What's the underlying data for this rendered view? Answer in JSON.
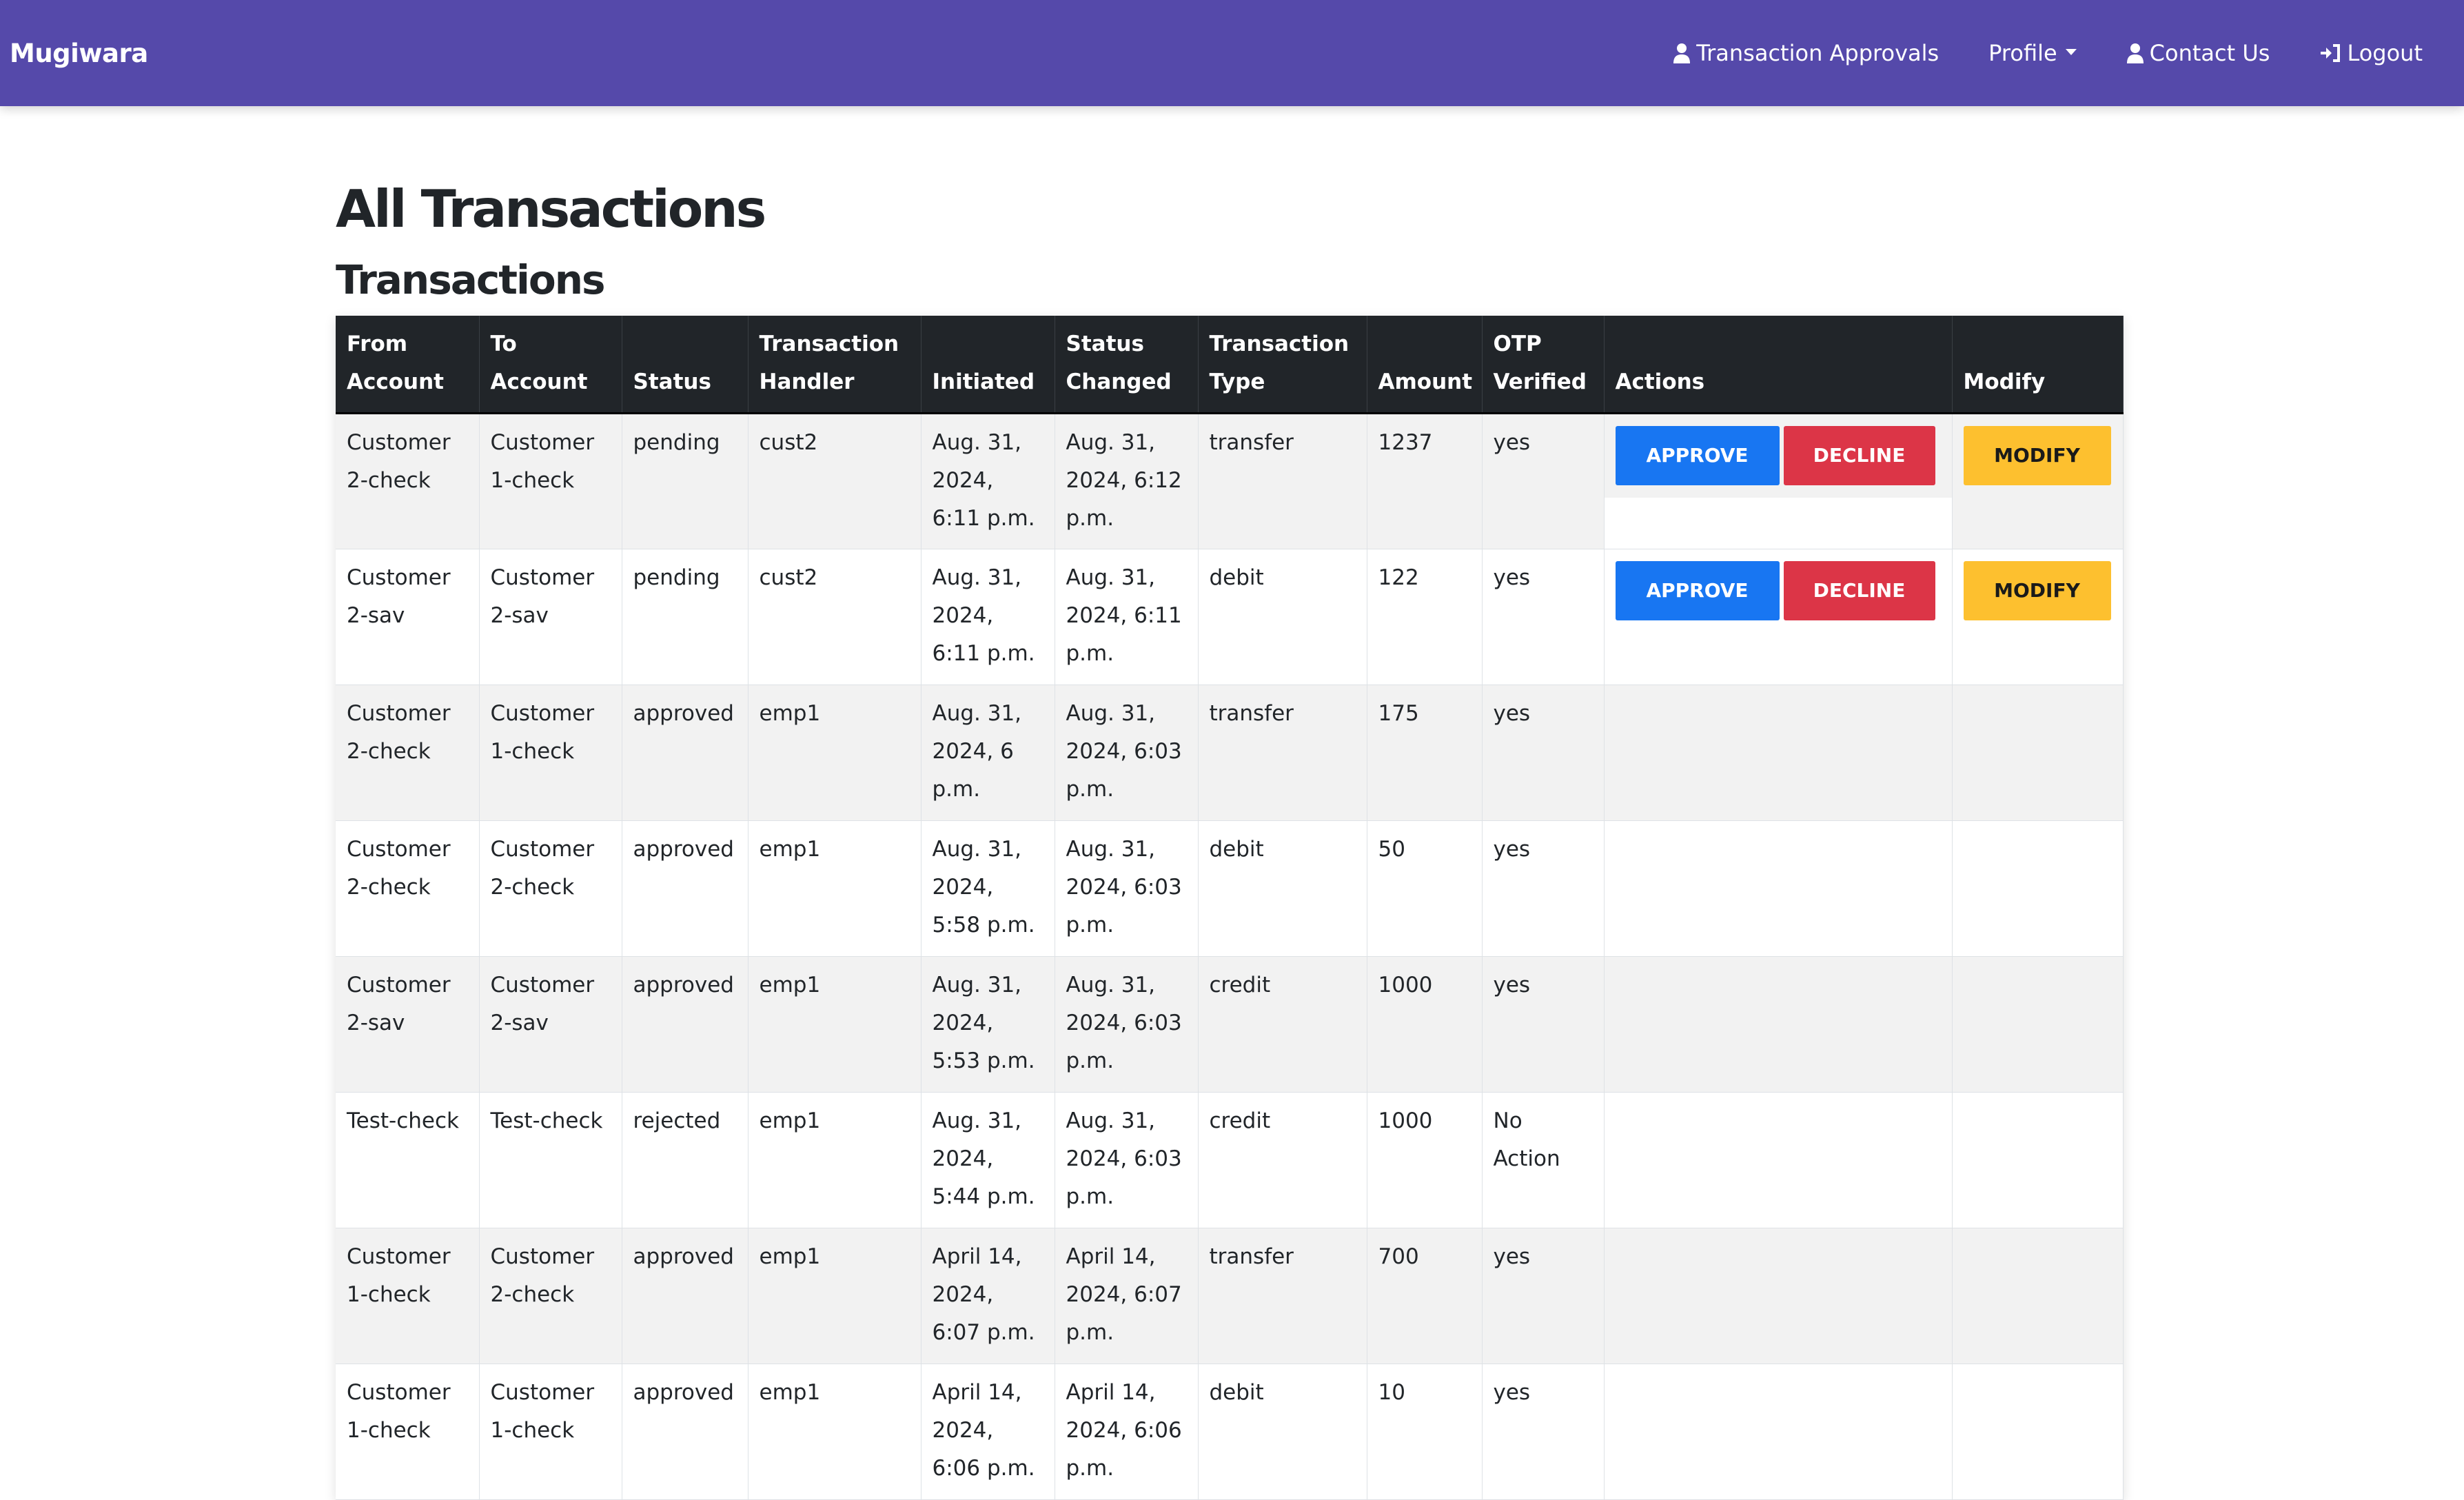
{
  "navbar": {
    "brand": "Mugiwara",
    "items": [
      {
        "label": "Transaction Approvals",
        "icon": "person-icon"
      },
      {
        "label": "Profile",
        "icon": "dropdown-caret-icon"
      },
      {
        "label": "Contact Us",
        "icon": "person-icon"
      },
      {
        "label": "Logout",
        "icon": "logout-icon"
      }
    ],
    "color": "#5549aa"
  },
  "page": {
    "title": "All Transactions",
    "subtitle": "Transactions"
  },
  "table": {
    "headers": [
      "From Account",
      "To Account",
      "Status",
      "Transaction Handler",
      "Initiated",
      "Status Changed",
      "Transaction Type",
      "Amount",
      "OTP Verified",
      "Actions",
      "Modify"
    ],
    "buttons": {
      "approve": "APPROVE",
      "decline": "DECLINE",
      "modify": "MODIFY"
    },
    "rows": [
      {
        "from": "Customer 2-check",
        "to": "Customer 1-check",
        "status": "pending",
        "handler": "cust2",
        "initiated": "Aug. 31, 2024, 6:11 p.m.",
        "changed": "Aug. 31, 2024, 6:12 p.m.",
        "type": "transfer",
        "amount": "1237",
        "otp": "yes",
        "actionable": true
      },
      {
        "from": "Customer 2-sav",
        "to": "Customer 2-sav",
        "status": "pending",
        "handler": "cust2",
        "initiated": "Aug. 31, 2024, 6:11 p.m.",
        "changed": "Aug. 31, 2024, 6:11 p.m.",
        "type": "debit",
        "amount": "122",
        "otp": "yes",
        "actionable": true
      },
      {
        "from": "Customer 2-check",
        "to": "Customer 1-check",
        "status": "approved",
        "handler": "emp1",
        "initiated": "Aug. 31, 2024, 6 p.m.",
        "changed": "Aug. 31, 2024, 6:03 p.m.",
        "type": "transfer",
        "amount": "175",
        "otp": "yes",
        "actionable": false
      },
      {
        "from": "Customer 2-check",
        "to": "Customer 2-check",
        "status": "approved",
        "handler": "emp1",
        "initiated": "Aug. 31, 2024, 5:58 p.m.",
        "changed": "Aug. 31, 2024, 6:03 p.m.",
        "type": "debit",
        "amount": "50",
        "otp": "yes",
        "actionable": false
      },
      {
        "from": "Customer 2-sav",
        "to": "Customer 2-sav",
        "status": "approved",
        "handler": "emp1",
        "initiated": "Aug. 31, 2024, 5:53 p.m.",
        "changed": "Aug. 31, 2024, 6:03 p.m.",
        "type": "credit",
        "amount": "1000",
        "otp": "yes",
        "actionable": false
      },
      {
        "from": "Test-check",
        "to": "Test-check",
        "status": "rejected",
        "handler": "emp1",
        "initiated": "Aug. 31, 2024, 5:44 p.m.",
        "changed": "Aug. 31, 2024, 6:03 p.m.",
        "type": "credit",
        "amount": "1000",
        "otp": "No Action",
        "actionable": false
      },
      {
        "from": "Customer 1-check",
        "to": "Customer 2-check",
        "status": "approved",
        "handler": "emp1",
        "initiated": "April 14, 2024, 6:07 p.m.",
        "changed": "April 14, 2024, 6:07 p.m.",
        "type": "transfer",
        "amount": "700",
        "otp": "yes",
        "actionable": false
      },
      {
        "from": "Customer 1-check",
        "to": "Customer 1-check",
        "status": "approved",
        "handler": "emp1",
        "initiated": "April 14, 2024, 6:06 p.m.",
        "changed": "April 14, 2024, 6:06 p.m.",
        "type": "debit",
        "amount": "10",
        "otp": "yes",
        "actionable": false
      }
    ]
  }
}
